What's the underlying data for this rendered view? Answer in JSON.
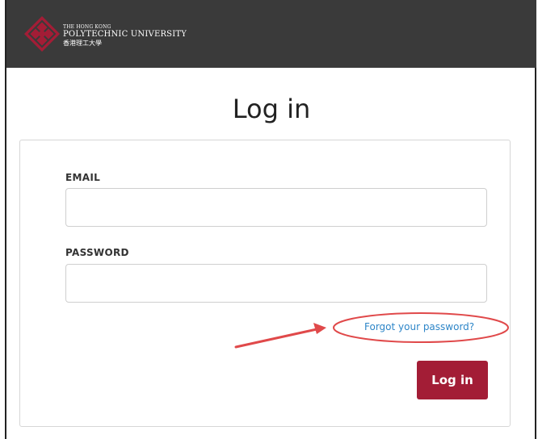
{
  "header": {
    "logo_line1": "THE HONG KONG",
    "logo_line2": "POLYTECHNIC UNIVERSITY",
    "logo_line3": "香港理工大學",
    "brand_color": "#a31d36",
    "bar_color": "#3a3a3a"
  },
  "page": {
    "title": "Log in"
  },
  "form": {
    "email_label": "EMAIL",
    "email_value": "",
    "password_label": "PASSWORD",
    "password_value": "",
    "forgot_link": "Forgot your password?",
    "submit_label": "Log in"
  },
  "annotations": {
    "highlight_color": "#e0494a",
    "arrow_icon": "red-arrow-icon"
  }
}
